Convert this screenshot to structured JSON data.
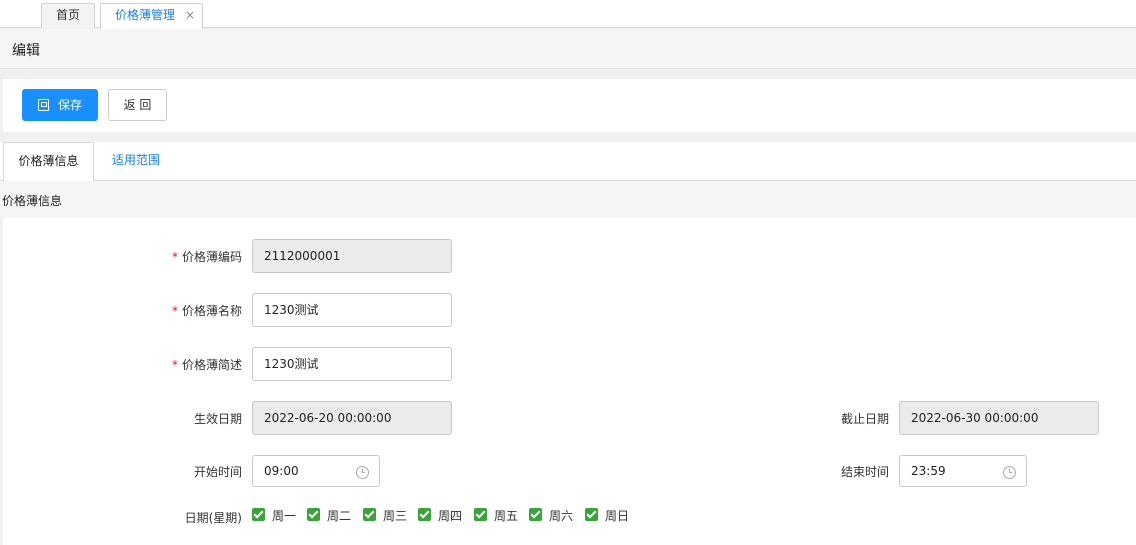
{
  "tabs": [
    {
      "label": "首页"
    },
    {
      "label": "价格薄管理",
      "close": "×"
    }
  ],
  "header": {
    "title": "编辑"
  },
  "toolbar": {
    "save_label": "保存",
    "back_label": "返 回"
  },
  "content_tabs": [
    {
      "label": "价格薄信息"
    },
    {
      "label": "适用范围"
    }
  ],
  "section": {
    "title": "价格薄信息"
  },
  "form": {
    "code": {
      "label": "价格薄编码",
      "value": "2112000001",
      "required": "*"
    },
    "name": {
      "label": "价格薄名称",
      "value": "1230测试",
      "required": "*"
    },
    "desc": {
      "label": "价格薄简述",
      "value": "1230测试",
      "required": "*"
    },
    "effective_date": {
      "label": "生效日期",
      "value": "2022-06-20 00:00:00"
    },
    "end_date": {
      "label": "截止日期",
      "value": "2022-06-30 00:00:00"
    },
    "start_time": {
      "label": "开始时间",
      "value": "09:00"
    },
    "end_time": {
      "label": "结束时间",
      "value": "23:59"
    },
    "weekday": {
      "label": "日期(星期)",
      "days": [
        "周一",
        "周二",
        "周三",
        "周四",
        "周五",
        "周六",
        "周日"
      ],
      "checked": [
        true,
        true,
        true,
        true,
        true,
        true,
        true
      ]
    }
  },
  "colors": {
    "primary": "#1890ff",
    "checkbox": "#3aa33a",
    "required": "#e02020"
  }
}
